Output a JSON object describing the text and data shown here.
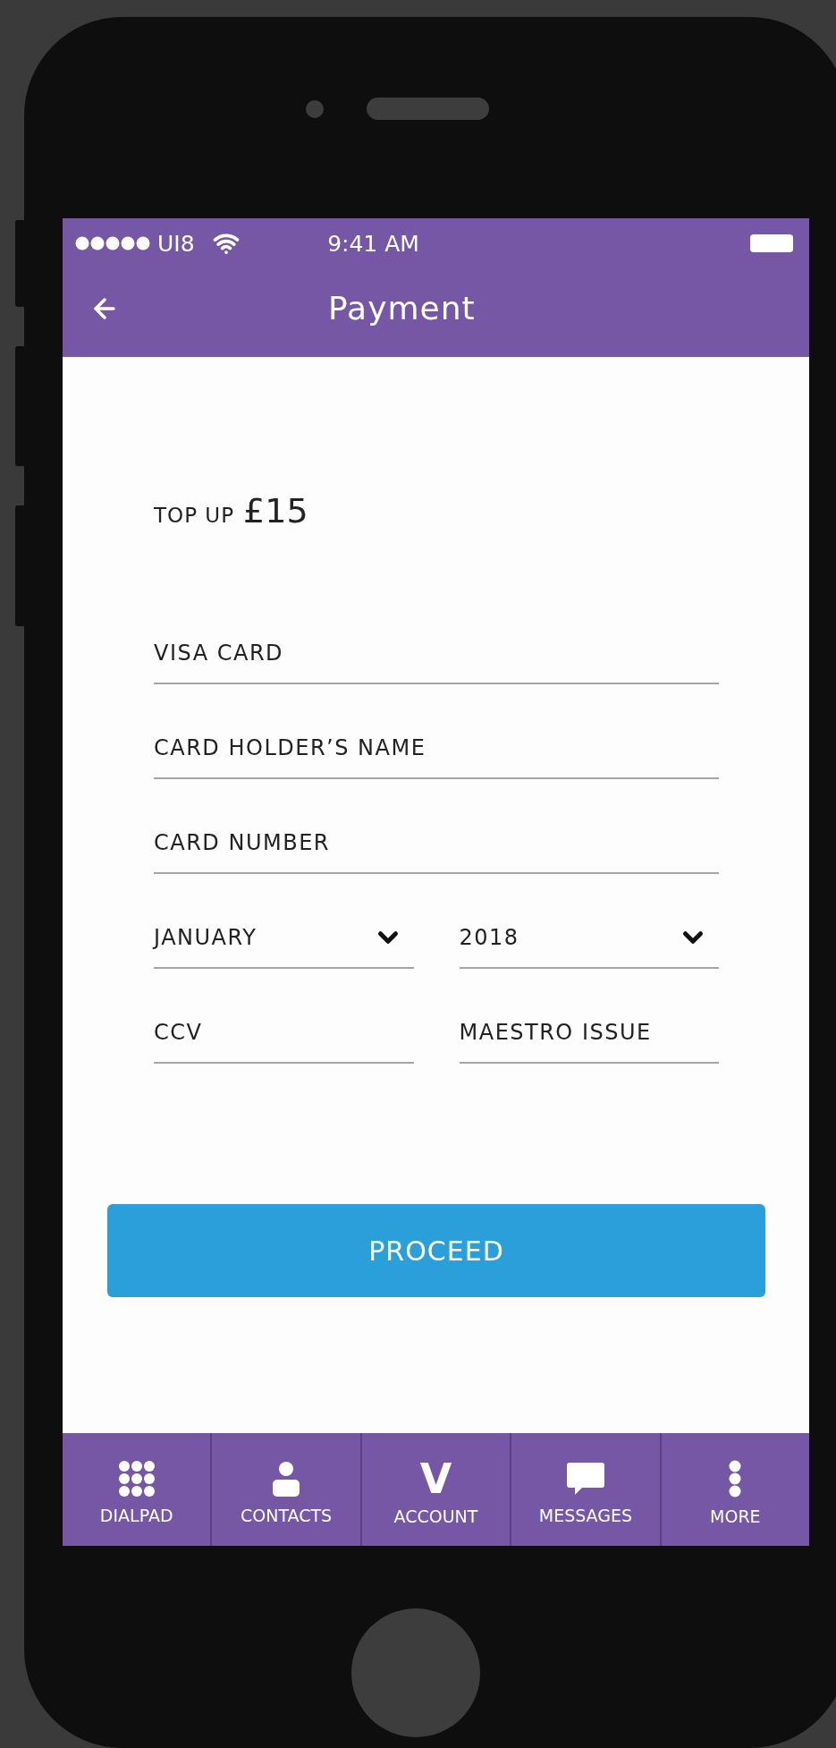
{
  "status_bar": {
    "carrier": "UI8",
    "time": "9:41 AM"
  },
  "header": {
    "title": "Payment"
  },
  "top_up": {
    "label": "TOP UP",
    "amount": "£15"
  },
  "form_rows": [
    {
      "fields": [
        {
          "kind": "text",
          "placeholder": "VISA CARD"
        }
      ]
    },
    {
      "fields": [
        {
          "kind": "text",
          "placeholder": "CARD HOLDER’S NAME"
        }
      ]
    },
    {
      "fields": [
        {
          "kind": "text",
          "placeholder": "CARD NUMBER"
        }
      ]
    },
    {
      "fields": [
        {
          "kind": "dropdown",
          "value": "JANUARY"
        },
        {
          "kind": "dropdown",
          "value": "2018"
        }
      ]
    },
    {
      "fields": [
        {
          "kind": "text",
          "placeholder": "CCV"
        },
        {
          "kind": "text",
          "placeholder": "MAESTRO ISSUE"
        }
      ]
    }
  ],
  "proceed_button": {
    "label": "PROCEED"
  },
  "bottom_nav": [
    {
      "kind": "dialpad",
      "label": "DIALPAD"
    },
    {
      "kind": "contacts",
      "label": "CONTACTS"
    },
    {
      "kind": "letter",
      "glyph": "V",
      "label": "ACCOUNT"
    },
    {
      "kind": "messages",
      "label": "MESSAGES"
    },
    {
      "kind": "more",
      "label": "MORE"
    }
  ]
}
